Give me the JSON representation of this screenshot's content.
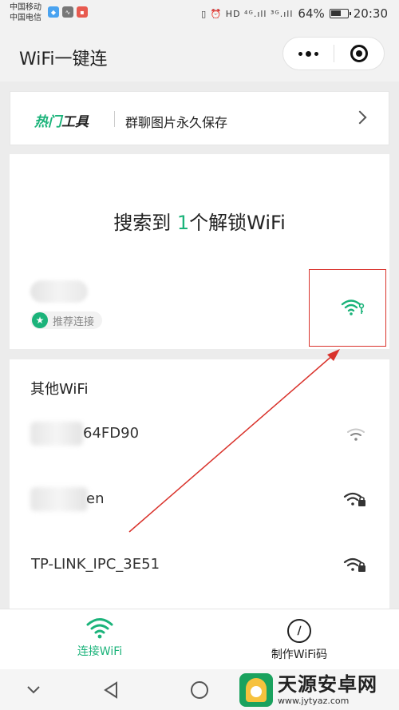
{
  "status_bar": {
    "carrier_1": "中国移动",
    "carrier_2": "中国电信",
    "icons": "▯ ⏰ HD ⁴ᴳ.ıll ³ᴳ.ıll",
    "battery_text": "64%",
    "battery_level": 0.64,
    "time": "20:30"
  },
  "app": {
    "title": "WiFi一键连"
  },
  "tools": {
    "hot_label_part1": "热门",
    "hot_label_part2": "工具",
    "text": "群聊图片永久保存"
  },
  "search": {
    "prefix": "搜索到 ",
    "count": "1",
    "suffix": "个解锁WiFi",
    "recommend_label": "推荐连接"
  },
  "other_wifi": {
    "title": "其他WiFi",
    "networks": [
      {
        "ssid": "64FD90",
        "locked": false
      },
      {
        "ssid": "en",
        "locked": true
      },
      {
        "ssid": "TP-LINK_IPC_3E51",
        "locked": true
      }
    ]
  },
  "tabbar": {
    "connect_label": "连接WiFi",
    "make_label": "制作WiFi码"
  },
  "watermark": {
    "name": "天源安卓网",
    "url": "www.jytyaz.com"
  },
  "colors": {
    "accent": "#1bb37a",
    "annotation": "#d9322b"
  }
}
